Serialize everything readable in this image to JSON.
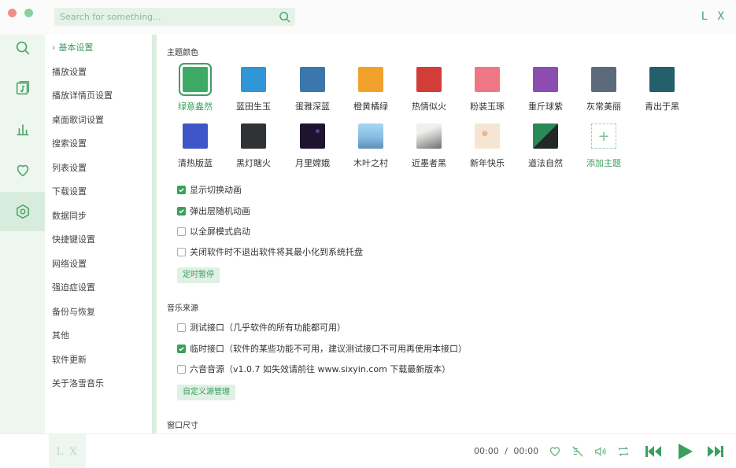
{
  "header": {
    "search_placeholder": "Search for something...",
    "logo": "L X"
  },
  "nav": [
    {
      "icon": "search-icon"
    },
    {
      "icon": "music-list-icon"
    },
    {
      "icon": "chart-icon"
    },
    {
      "icon": "heart-icon"
    },
    {
      "icon": "settings-icon",
      "active": true
    }
  ],
  "menu": [
    "基本设置",
    "播放设置",
    "播放详情页设置",
    "桌面歌词设置",
    "搜索设置",
    "列表设置",
    "下载设置",
    "数据同步",
    "快捷键设置",
    "网络设置",
    "强迫症设置",
    "备份与恢复",
    "其他",
    "软件更新",
    "关于洛雪音乐"
  ],
  "sections": {
    "theme_title": "主题颜色",
    "music_source_title": "音乐来源",
    "window_size_title": "窗口尺寸"
  },
  "themes": [
    {
      "name": "绿意盎然",
      "color": "#3eaa67",
      "selected": true
    },
    {
      "name": "蓝田生玉",
      "color": "#2f96d8"
    },
    {
      "name": "蛋雅深蓝",
      "color": "#3a78ab"
    },
    {
      "name": "橙黄橘绿",
      "color": "#f2a22c"
    },
    {
      "name": "热情似火",
      "color": "#d23d3a"
    },
    {
      "name": "粉装玉琢",
      "color": "#ee7785"
    },
    {
      "name": "重斤球紫",
      "color": "#8c4db1"
    },
    {
      "name": "灰常美丽",
      "color": "#5c6a7b"
    },
    {
      "name": "青出于黑",
      "color": "#23606c"
    },
    {
      "name": "清热版蓝",
      "color": "#3e56c8"
    },
    {
      "name": "黑灯瞎火",
      "color": "#2f3335"
    },
    {
      "name": "月里嫦娥",
      "color": "#1e1430"
    },
    {
      "name": "木叶之村",
      "color": "#86bde3"
    },
    {
      "name": "近墨者黑",
      "color": "#d4d6d3"
    },
    {
      "name": "新年快乐",
      "color": "#f5e6d4"
    },
    {
      "name": "道法自然",
      "color": "#2a8a55"
    }
  ],
  "add_theme_label": "添加主题",
  "options": [
    {
      "label": "显示切换动画",
      "checked": true
    },
    {
      "label": "弹出层随机动画",
      "checked": true
    },
    {
      "label": "以全屏模式启动",
      "checked": false
    },
    {
      "label": "关闭软件时不退出软件将其最小化到系统托盘",
      "checked": false
    }
  ],
  "timer_button": "定时暂停",
  "sources": [
    {
      "label": "测试接口（几乎软件的所有功能都可用）",
      "checked": false
    },
    {
      "label": "临时接口（软件的某些功能不可用，建议测试接口不可用再使用本接口）",
      "checked": true
    },
    {
      "label": "六音音源（v1.0.7 如失效请前往 www.sixyin.com 下载最新版本）",
      "checked": false
    }
  ],
  "custom_source_button": "自定义源管理",
  "player": {
    "cover_text": "L X",
    "current_time": "00:00",
    "separator": "/",
    "total_time": "00:00"
  },
  "colors": {
    "accent": "#3aa05e",
    "nav_bg": "#eef6f0"
  }
}
